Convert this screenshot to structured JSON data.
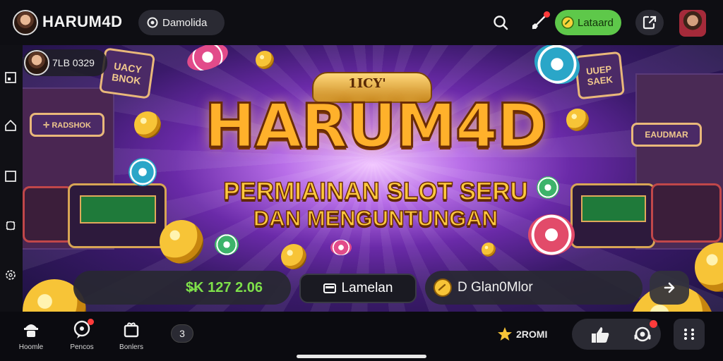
{
  "header": {
    "brand": "HARUM4D",
    "pill_label": "Damolida",
    "action_label": "Lataard"
  },
  "user_chip": {
    "text": "7LB 0329"
  },
  "banner": {
    "title_tag": "1ICY'",
    "title": "HARUM4D",
    "subtitle_line1": "PERMIAINAN SLOT SERU",
    "subtitle_line2": "DAN MENGUNTUNGAN",
    "signs": {
      "left_top": "UACY\nBNOK",
      "left_mid": "✛ RADSHOK",
      "right_top": "UUEP\nSAEK",
      "right_mid": "EAUDMAR"
    }
  },
  "controls": {
    "balance": "$̶K 127 2.06",
    "menu_label": "Lamelan",
    "game_label": "D Glan0Mlor"
  },
  "bottom_nav": {
    "items": [
      {
        "label": "Hoomle"
      },
      {
        "label": "Pencos"
      },
      {
        "label": "Bonlers"
      }
    ],
    "counter": "3",
    "points": "2ROMI"
  },
  "colors": {
    "accent_green": "#5ec84a",
    "balance_green": "#7ee04a",
    "notification_red": "#ff3b3b",
    "gold": "#f7c437"
  },
  "icons": [
    "search-icon",
    "rocket-icon",
    "coin-icon",
    "exit-icon",
    "home-icon",
    "square-icon",
    "gear-icon",
    "settings-icon",
    "arrow-right-icon",
    "star-icon",
    "thumbs-icon",
    "support-icon",
    "grid-icon"
  ]
}
